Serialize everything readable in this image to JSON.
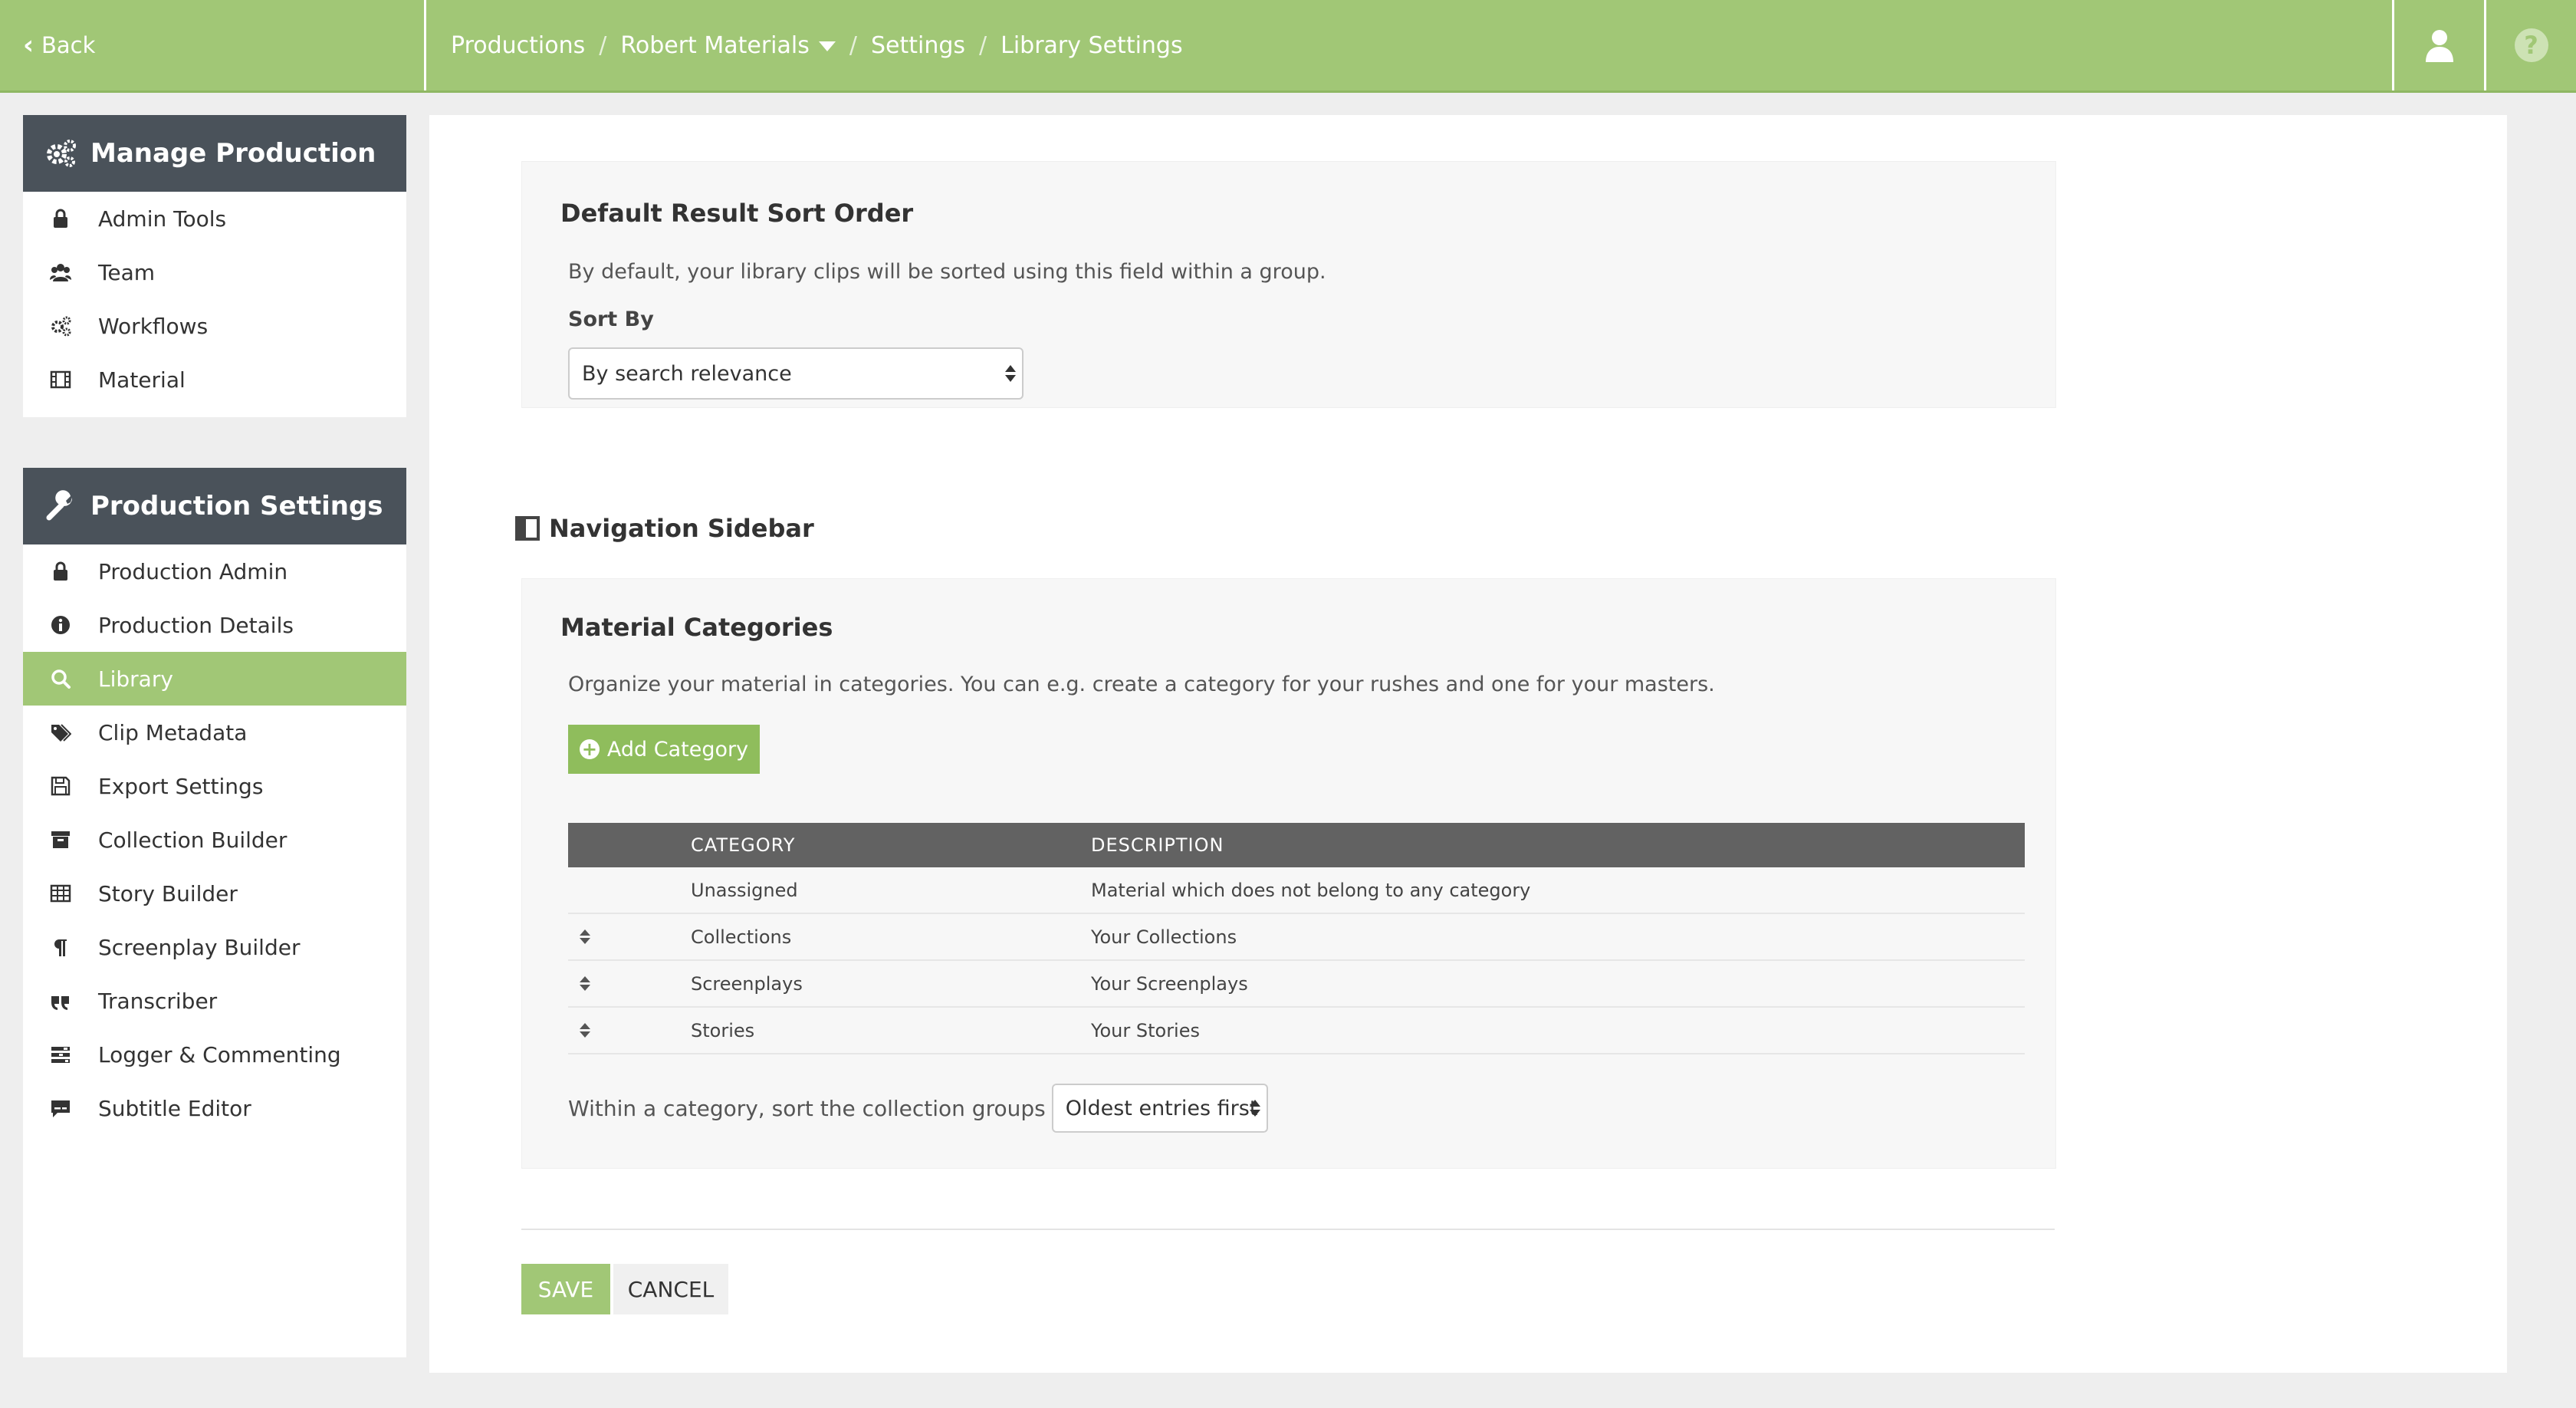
{
  "topbar": {
    "back_label": "Back",
    "breadcrumbs": [
      "Productions",
      "Robert Materials",
      "Settings",
      "Library Settings"
    ],
    "separator": "/"
  },
  "sidebar": {
    "manage": {
      "title": "Manage Production",
      "items": [
        {
          "label": "Admin Tools",
          "icon": "lock-icon"
        },
        {
          "label": "Team",
          "icon": "users-icon"
        },
        {
          "label": "Workflows",
          "icon": "gears-icon"
        },
        {
          "label": "Material",
          "icon": "film-icon"
        }
      ]
    },
    "settings": {
      "title": "Production Settings",
      "items": [
        {
          "label": "Production Admin",
          "icon": "lock-icon"
        },
        {
          "label": "Production Details",
          "icon": "info-icon"
        },
        {
          "label": "Library",
          "icon": "search-icon",
          "active": true
        },
        {
          "label": "Clip Metadata",
          "icon": "tags-icon"
        },
        {
          "label": "Export Settings",
          "icon": "floppy-icon"
        },
        {
          "label": "Collection Builder",
          "icon": "archive-icon"
        },
        {
          "label": "Story Builder",
          "icon": "table-icon"
        },
        {
          "label": "Screenplay Builder",
          "icon": "paragraph-icon"
        },
        {
          "label": "Transcriber",
          "icon": "quote-icon"
        },
        {
          "label": "Logger & Commenting",
          "icon": "tasks-icon"
        },
        {
          "label": "Subtitle Editor",
          "icon": "subtitle-icon"
        }
      ]
    }
  },
  "sort_section": {
    "title": "Default Result Sort Order",
    "description": "By default, your library clips will be sorted using this field within a group.",
    "sort_by_label": "Sort By",
    "sort_by_value": "By search relevance"
  },
  "nav_section": {
    "heading": "Navigation Sidebar"
  },
  "categories": {
    "title": "Material Categories",
    "description": "Organize your material in categories. You can e.g. create a category for your rushes and one for your masters.",
    "add_button": "Add Category",
    "columns": [
      "CATEGORY",
      "DESCRIPTION"
    ],
    "rows": [
      {
        "category": "Unassigned",
        "description": "Material which does not belong to any category",
        "sortable": false
      },
      {
        "category": "Collections",
        "description": "Your Collections",
        "sortable": true
      },
      {
        "category": "Screenplays",
        "description": "Your Screenplays",
        "sortable": true
      },
      {
        "category": "Stories",
        "description": "Your Stories",
        "sortable": true
      }
    ],
    "group_sort_label": "Within a category, sort the collection groups",
    "group_sort_value": "Oldest entries first"
  },
  "actions": {
    "save": "SAVE",
    "cancel": "CANCEL"
  },
  "colors": {
    "accent": "#a1c776",
    "panel_header": "#4a525a",
    "table_header": "#626262"
  }
}
